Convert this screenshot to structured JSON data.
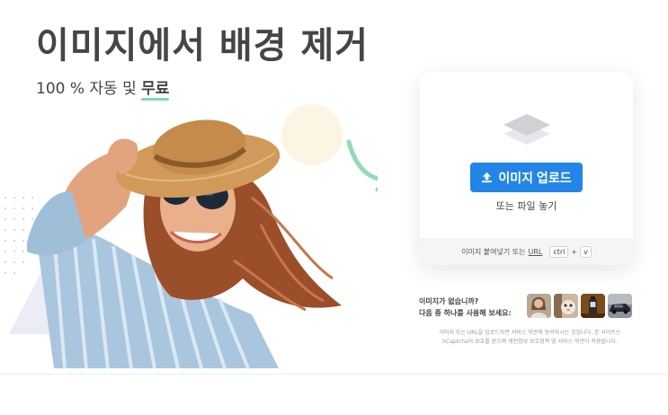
{
  "hero": {
    "title": "이미지에서 배경 제거",
    "subtitle_prefix": "100 % 자동 및 ",
    "subtitle_free": "무료"
  },
  "upload": {
    "button_label": "이미지 업로드",
    "drop_text": "또는 파일 놓기",
    "paste_text": "이미지 붙여넣기 또는",
    "url_label": "URL",
    "key_ctrl": "ctrl",
    "key_plus": "+",
    "key_v": "v",
    "accent_color": "#2385e8"
  },
  "samples": {
    "line1": "이미지가 없습니까?",
    "line2": "다음 중 하나를 사용해 보세요:",
    "items": [
      "sample-woman",
      "sample-animal",
      "sample-product",
      "sample-car"
    ]
  },
  "legal": {
    "line1": "이미지 또는 URL을 업로드하면 서비스 약관에 동의하시는 것입니다. 본 사이트는",
    "line2": "hCaptcha의 보호를 받으며 개인정보 보호정책 및 서비스 약관이 적용됩니다."
  },
  "icons": {
    "layers": "layers-icon",
    "upload_arrow": "upload-arrow-icon",
    "curved_arrow": "curved-arrow-icon"
  },
  "colors": {
    "free_underline": "#7ed9b3",
    "arrow_green": "#8fdcb5"
  }
}
